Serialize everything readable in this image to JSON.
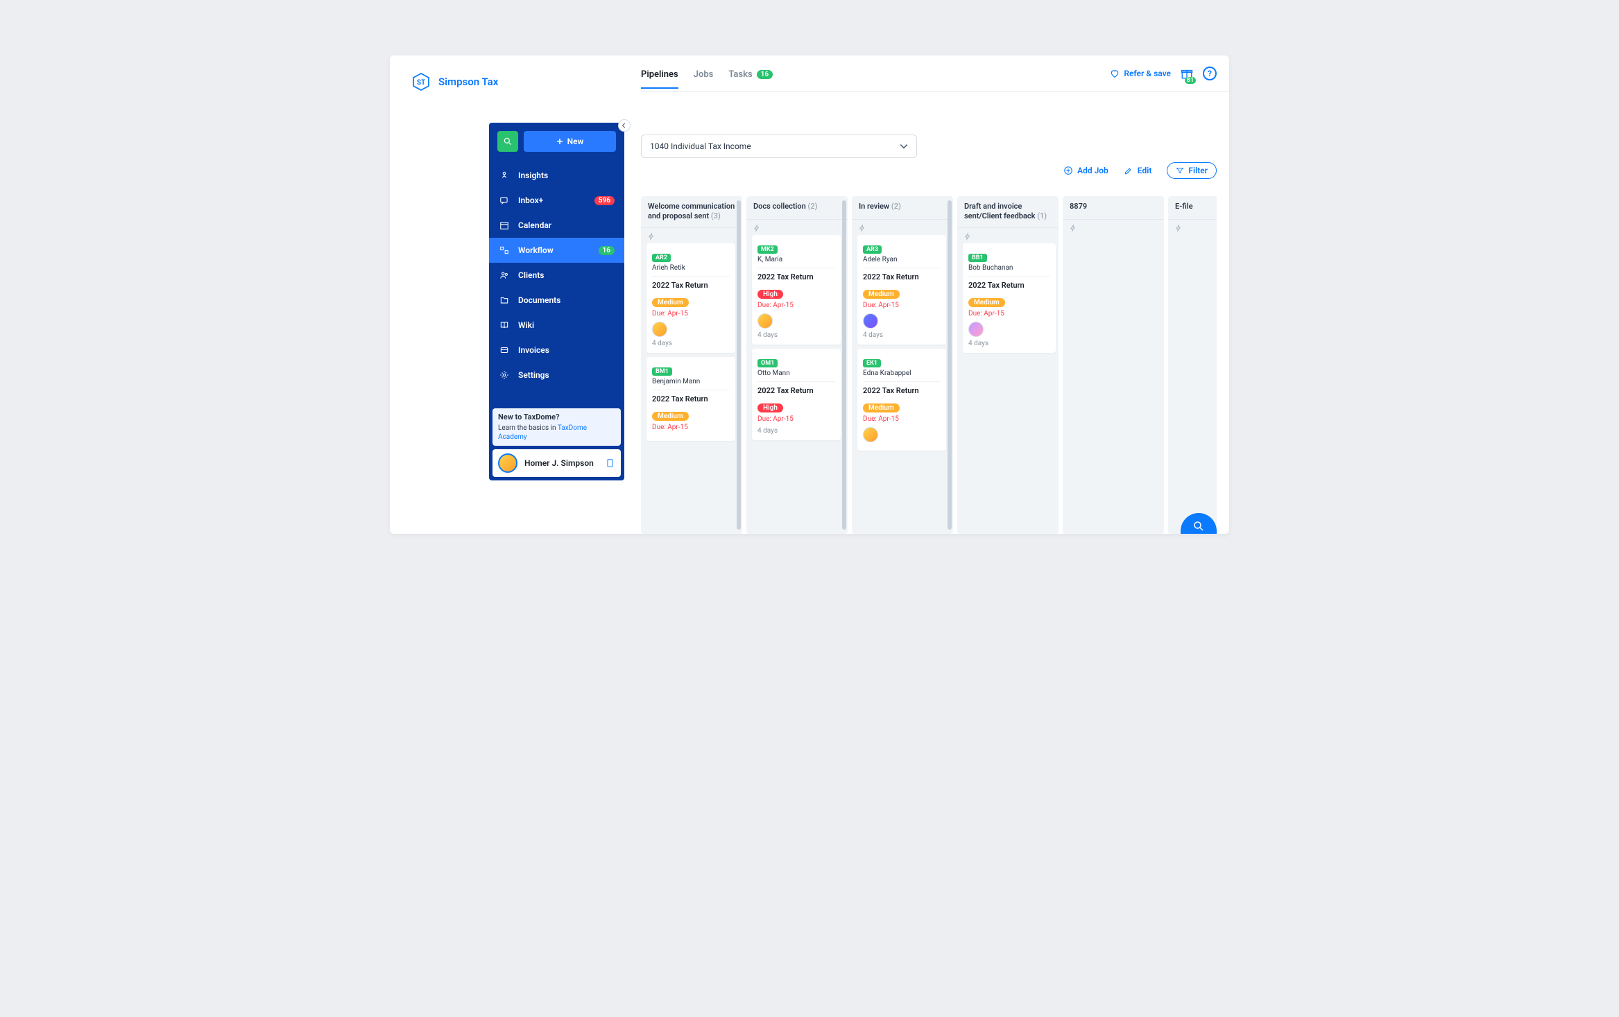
{
  "brand": {
    "initials": "ST",
    "name": "Simpson Tax"
  },
  "tabs": {
    "pipelines": "Pipelines",
    "jobs": "Jobs",
    "tasks": "Tasks",
    "tasks_count": "16"
  },
  "top_actions": {
    "refer": "Refer & save",
    "gift_badge": "81",
    "help": "?"
  },
  "sidebar": {
    "new": "New",
    "items": [
      {
        "label": "Insights"
      },
      {
        "label": "Inbox+",
        "badge": "596",
        "badge_class": "badge-red"
      },
      {
        "label": "Calendar"
      },
      {
        "label": "Workflow",
        "badge": "16",
        "badge_class": "badge-green",
        "active": true
      },
      {
        "label": "Clients"
      },
      {
        "label": "Documents"
      },
      {
        "label": "Wiki"
      },
      {
        "label": "Invoices"
      },
      {
        "label": "Settings"
      }
    ],
    "academy_title": "New to TaxDome?",
    "academy_text_prefix": "Learn the basics in ",
    "academy_link": "TaxDome Academy",
    "user": "Homer J. Simpson"
  },
  "pipeline_select": "1040 Individual Tax Income",
  "board_actions": {
    "add_job": "Add Job",
    "edit": "Edit",
    "filter": "Filter"
  },
  "columns": [
    {
      "title": "Welcome communication and proposal sent",
      "count": "(3)",
      "scroll": true,
      "cards": [
        {
          "chip": "AR2",
          "client": "Arieh Retik",
          "job": "2022 Tax Return",
          "prio": "Medium",
          "prio_class": "prio-med",
          "due": "Due: Apr-15",
          "assignee": "homer",
          "days": "4 days"
        },
        {
          "chip": "BM1",
          "client": "Benjamin Mann",
          "job": "2022 Tax Return",
          "prio": "Medium",
          "prio_class": "prio-med",
          "due": "Due: Apr-15"
        }
      ]
    },
    {
      "title": "Docs collection",
      "count": "(2)",
      "scroll": true,
      "cards": [
        {
          "chip": "MK2",
          "client": "K, Maria",
          "job": "2022 Tax Return",
          "prio": "High",
          "prio_class": "prio-high",
          "due": "Due: Apr-15",
          "assignee": "homer",
          "days": "4 days"
        },
        {
          "chip": "OM1",
          "client": "Otto Mann",
          "job": "2022 Tax Return",
          "prio": "High",
          "prio_class": "prio-high",
          "due": "Due: Apr-15",
          "days": "4 days"
        }
      ]
    },
    {
      "title": "In review",
      "count": "(2)",
      "scroll": true,
      "cards": [
        {
          "chip": "AR3",
          "client": "Adele Ryan",
          "job": "2022 Tax Return",
          "prio": "Medium",
          "prio_class": "prio-med",
          "due": "Due: Apr-15",
          "assignee": "marge",
          "days": "4 days"
        },
        {
          "chip": "EK1",
          "client": "Edna Krabappel",
          "job": "2022 Tax Return",
          "prio": "Medium",
          "prio_class": "prio-med",
          "due": "Due: Apr-15",
          "assignee": "homer"
        }
      ]
    },
    {
      "title": "Draft and invoice sent/Client feedback",
      "count": "(1)",
      "cards": [
        {
          "chip": "BB1",
          "client": "Bob Buchanan",
          "job": "2022 Tax Return",
          "prio": "Medium",
          "prio_class": "prio-med",
          "due": "Due: Apr-15",
          "assignee": "bart",
          "days": "4 days"
        }
      ]
    },
    {
      "title": "8879",
      "cards": []
    },
    {
      "title": "E-file",
      "cards": []
    }
  ]
}
